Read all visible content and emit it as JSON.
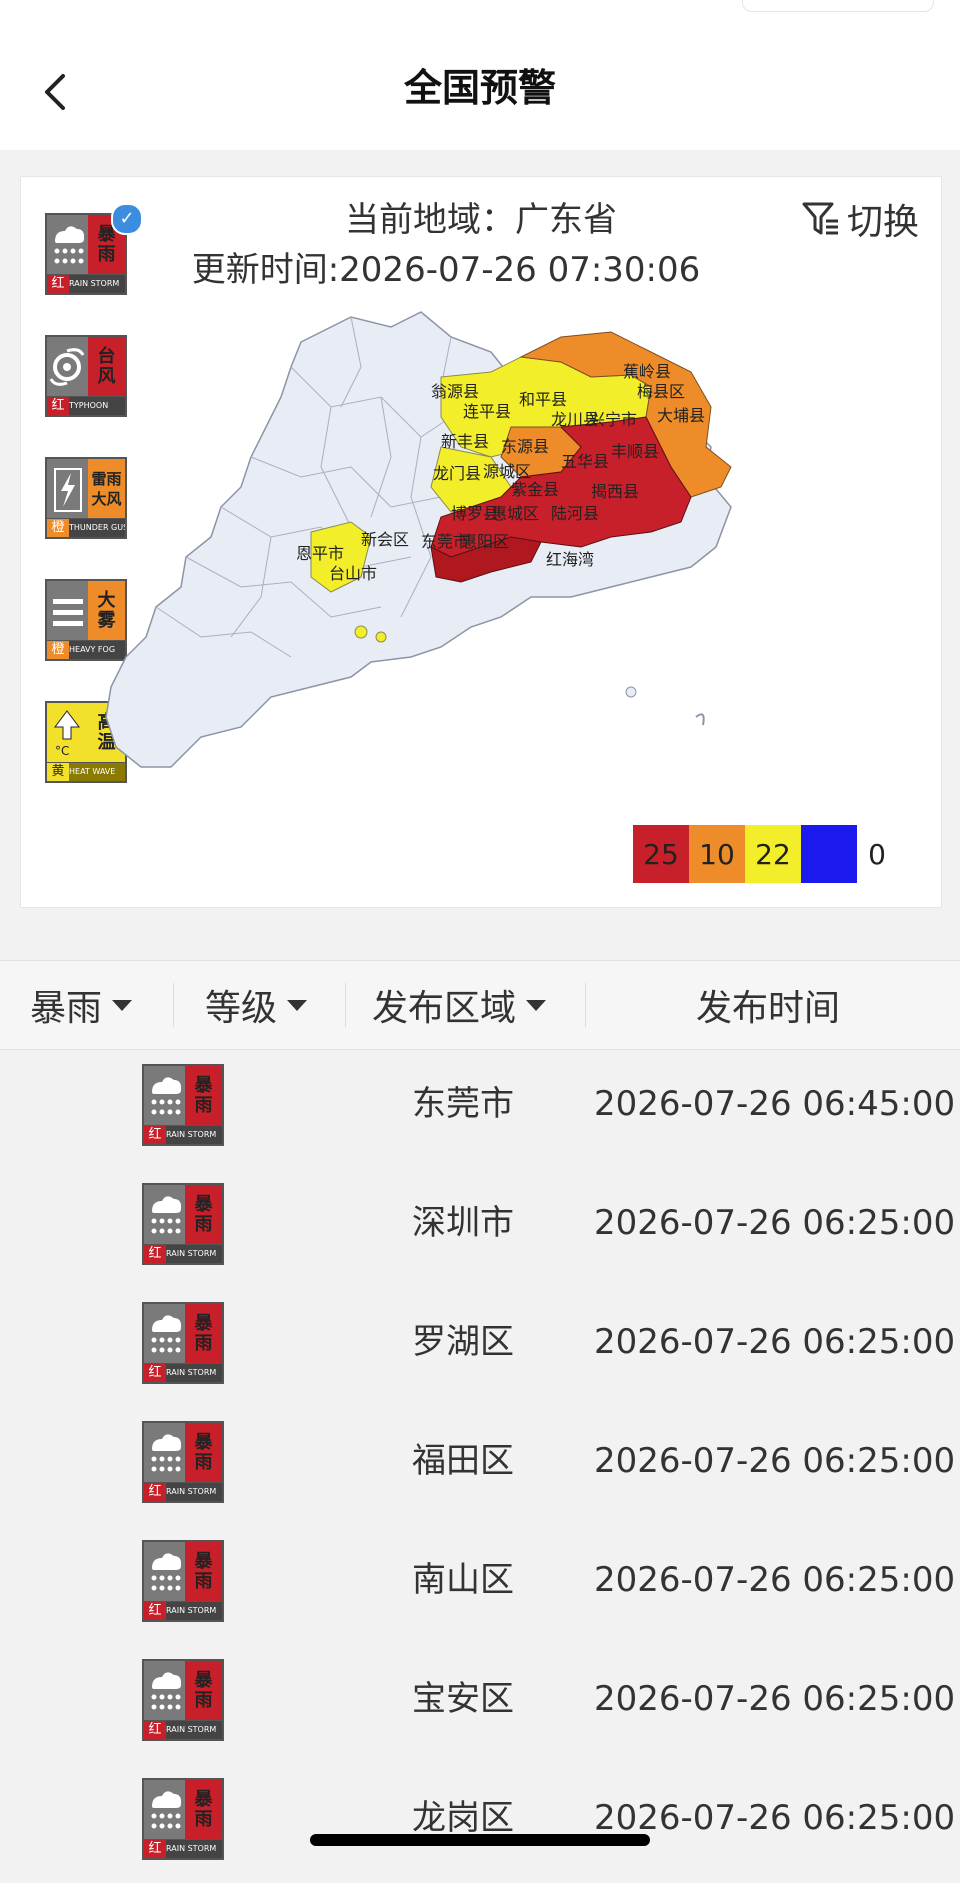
{
  "header": {
    "title": "全国预警"
  },
  "card": {
    "region_label": "当前地域：广东省",
    "update_label": "更新时间:2026-07-26 07:30:06",
    "switch_label": "切换",
    "warnings": [
      {
        "id": "rainstorm",
        "line1": "暴",
        "line2": "雨",
        "level": "红",
        "en": "RAIN STORM",
        "color": "#c8202a",
        "icon": "rain-cloud-icon",
        "selected": true
      },
      {
        "id": "typhoon",
        "line1": "台",
        "line2": "风",
        "level": "红",
        "en": "TYPHOON",
        "color": "#c8202a",
        "icon": "typhoon-icon",
        "selected": false
      },
      {
        "id": "thundergust",
        "line1": "雷雨",
        "line2": "大风",
        "level": "橙",
        "en": "THUNDER GUST",
        "color": "#ef8c2a",
        "icon": "lightning-icon",
        "selected": false
      },
      {
        "id": "heavyfog",
        "line1": "大",
        "line2": "雾",
        "level": "橙",
        "en": "HEAVY FOG",
        "color": "#ef8c2a",
        "icon": "fog-icon",
        "selected": false
      },
      {
        "id": "heatwave",
        "line1": "高",
        "line2": "温",
        "level": "黄",
        "en": "HEAT WAVE",
        "color": "#f2e02a",
        "icon": "thermometer-icon",
        "selected": false
      }
    ],
    "map_labels": [
      "翁源县",
      "连平县",
      "和平县",
      "龙川县",
      "兴宁市",
      "蕉岭县",
      "梅县区",
      "大埔县",
      "新丰县",
      "东源县",
      "五华县",
      "丰顺县",
      "龙门县",
      "源城区",
      "紫金县",
      "揭西县",
      "博罗县",
      "惠城区",
      "陆河县",
      "东莞市",
      "惠阳区",
      "新会区",
      "恩平市",
      "台山市",
      "红海湾"
    ],
    "legend": [
      {
        "label": "25",
        "color": "#c8202a"
      },
      {
        "label": "10",
        "color": "#ef8c2a"
      },
      {
        "label": "22",
        "color": "#f2ee2a"
      },
      {
        "label": "0",
        "color": "#1a1aee"
      }
    ],
    "legend_tail": "0"
  },
  "table": {
    "headers": {
      "type": "暴雨",
      "level": "等级",
      "area": "发布区域",
      "time": "发布时间"
    },
    "rows": [
      {
        "area": "东莞市",
        "time": "2026-07-26 06:45:00",
        "line1": "暴",
        "line2": "雨",
        "level": "红",
        "en": "RAIN STORM"
      },
      {
        "area": "深圳市",
        "time": "2026-07-26 06:25:00",
        "line1": "暴",
        "line2": "雨",
        "level": "红",
        "en": "RAIN STORM"
      },
      {
        "area": "罗湖区",
        "time": "2026-07-26 06:25:00",
        "line1": "暴",
        "line2": "雨",
        "level": "红",
        "en": "RAIN STORM"
      },
      {
        "area": "福田区",
        "time": "2026-07-26 06:25:00",
        "line1": "暴",
        "line2": "雨",
        "level": "红",
        "en": "RAIN STORM"
      },
      {
        "area": "南山区",
        "time": "2026-07-26 06:25:00",
        "line1": "暴",
        "line2": "雨",
        "level": "红",
        "en": "RAIN STORM"
      },
      {
        "area": "宝安区",
        "time": "2026-07-26 06:25:00",
        "line1": "暴",
        "line2": "雨",
        "level": "红",
        "en": "RAIN STORM"
      },
      {
        "area": "龙岗区",
        "time": "2026-07-26 06:25:00",
        "line1": "暴",
        "line2": "雨",
        "level": "红",
        "en": "RAIN STORM"
      }
    ]
  }
}
